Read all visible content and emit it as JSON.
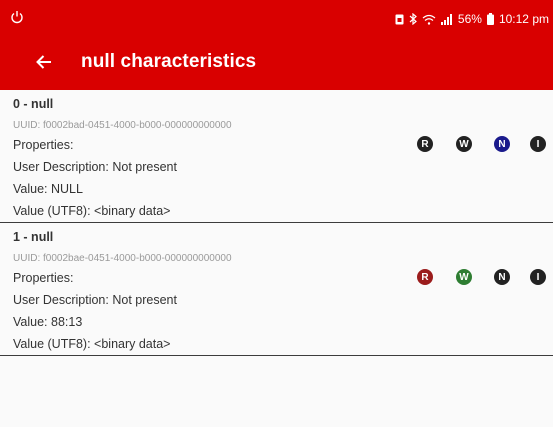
{
  "status_bar": {
    "battery_percent": "56%",
    "time": "10:12 pm"
  },
  "app_bar": {
    "title": "null characteristics",
    "back_icon": "arrow-left-icon"
  },
  "characteristics": [
    {
      "name": "0 - null",
      "uuid": "UUID: f0002bad-0451-4000-b000-000000000000",
      "properties_label": "Properties:",
      "user_description": "User Description: Not present",
      "value": "Value: NULL",
      "value_utf8": "Value (UTF8): <binary data>",
      "property_icons": [
        {
          "letter": "R",
          "color": "#222222"
        },
        {
          "letter": "W",
          "color": "#222222"
        },
        {
          "letter": "N",
          "color": "#1a1a8c"
        },
        {
          "letter": "I",
          "color": "#222222"
        }
      ]
    },
    {
      "name": "1 - null",
      "uuid": "UUID: f0002bae-0451-4000-b000-000000000000",
      "properties_label": "Properties:",
      "user_description": "User Description: Not present",
      "value": "Value: 88:13",
      "value_utf8": "Value (UTF8): <binary data>",
      "property_icons": [
        {
          "letter": "R",
          "color": "#9b1c1c"
        },
        {
          "letter": "W",
          "color": "#2e7d32"
        },
        {
          "letter": "N",
          "color": "#222222"
        },
        {
          "letter": "I",
          "color": "#222222"
        }
      ]
    }
  ],
  "colors": {
    "accent": "#d90000",
    "background": "#fafafa",
    "text": "#333333",
    "uuid_text": "#9a9a9a"
  }
}
